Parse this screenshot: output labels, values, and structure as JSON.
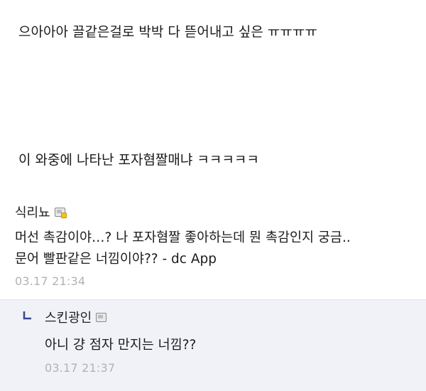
{
  "post": {
    "lines": [
      "으아아아 끌같은걸로 박박 다 뜯어내고 싶은 ㅠㅠㅠㅠ",
      "이 와중에 나타난 포자혐짤매냐 ㅋㅋㅋㅋㅋ"
    ]
  },
  "comment": {
    "nickname": "식리뇨",
    "badge_icon": "member-badge-icon",
    "body_lines": [
      "머선 촉감이야…? 나 포자혐짤 좋아하는데 뭔 촉감인지 궁금..",
      "문어 빨판같은 너낌이야?? - dc App"
    ],
    "timestamp": "03.17 21:34"
  },
  "reply": {
    "arrow_icon": "reply-arrow-icon",
    "nickname": "스킨광인",
    "badge_icon": "member-badge-icon",
    "body": "아니 걍 점자 만지는 너낌??",
    "timestamp": "03.17 21:37"
  },
  "colors": {
    "text": "#1c1c1c",
    "timestamp": "#b2b2b2",
    "reply_background": "#f1f2f8",
    "reply_arrow": "#3b4890",
    "badge_dot": "#f4c21a"
  }
}
